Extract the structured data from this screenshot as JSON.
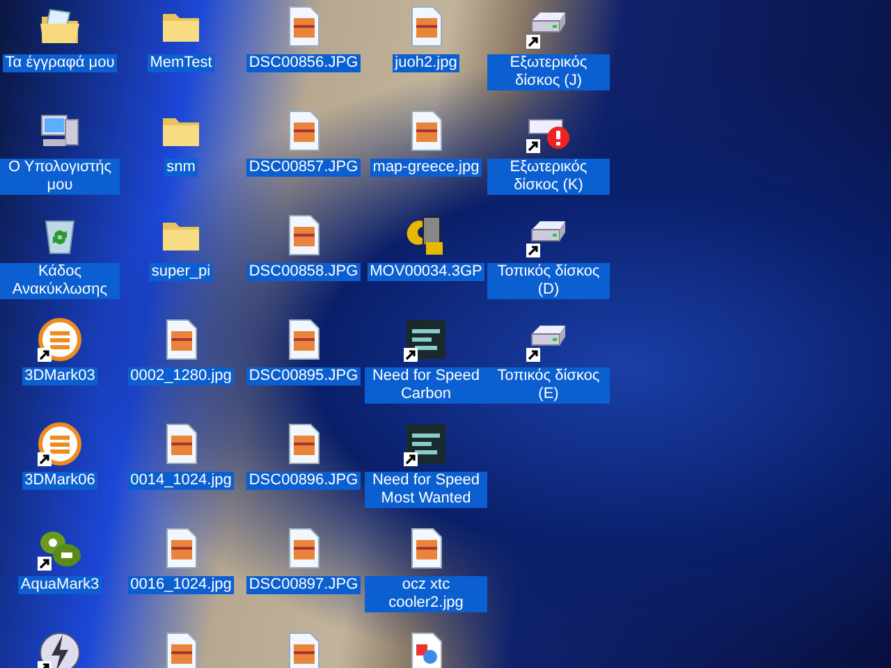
{
  "desktop": {
    "icons": [
      {
        "kind": "documents",
        "label": "Τα έγγραφά μου",
        "shortcut": false,
        "selected": true
      },
      {
        "kind": "computer",
        "label": "Ο Υπολογιστής μου",
        "shortcut": false,
        "selected": true
      },
      {
        "kind": "recycle",
        "label": "Κάδος Ανακύκλωσης",
        "shortcut": false,
        "selected": true
      },
      {
        "kind": "benchmark",
        "label": "3DMark03",
        "shortcut": true,
        "selected": true
      },
      {
        "kind": "benchmark",
        "label": "3DMark06",
        "shortcut": true,
        "selected": true
      },
      {
        "kind": "aquamark",
        "label": "AquaMark3",
        "shortcut": true,
        "selected": true
      },
      {
        "kind": "lightning",
        "shortcut": true
      },
      {
        "kind": "folder",
        "label": "MemTest",
        "shortcut": false,
        "selected": true
      },
      {
        "kind": "folder",
        "label": "snm",
        "shortcut": false,
        "selected": true
      },
      {
        "kind": "folder",
        "label": "super_pi",
        "shortcut": false,
        "selected": true
      },
      {
        "kind": "image",
        "label": "0002_1280.jpg",
        "shortcut": false,
        "selected": true
      },
      {
        "kind": "image",
        "label": "0014_1024.jpg",
        "shortcut": false,
        "selected": true
      },
      {
        "kind": "image",
        "label": "0016_1024.jpg",
        "shortcut": false,
        "selected": true
      },
      {
        "kind": "image"
      },
      {
        "kind": "image",
        "label": "DSC00856.JPG",
        "shortcut": false,
        "selected": true
      },
      {
        "kind": "image",
        "label": "DSC00857.JPG",
        "shortcut": false,
        "selected": true
      },
      {
        "kind": "image",
        "label": "DSC00858.JPG",
        "shortcut": false,
        "selected": true
      },
      {
        "kind": "image",
        "label": "DSC00895.JPG",
        "shortcut": false,
        "selected": true
      },
      {
        "kind": "image",
        "label": "DSC00896.JPG",
        "shortcut": false,
        "selected": true
      },
      {
        "kind": "image",
        "label": "DSC00897.JPG",
        "shortcut": false,
        "selected": true
      },
      {
        "kind": "image"
      },
      {
        "kind": "image",
        "label": "juoh2.jpg",
        "shortcut": false,
        "selected": true
      },
      {
        "kind": "image",
        "label": "map-greece.jpg",
        "shortcut": false,
        "selected": true
      },
      {
        "kind": "video",
        "label": "MOV00034.3GP",
        "shortcut": false,
        "selected": true
      },
      {
        "kind": "game",
        "label": "Need for Speed Carbon",
        "shortcut": true,
        "selected": true
      },
      {
        "kind": "game",
        "label": "Need for Speed Most Wanted",
        "shortcut": true,
        "selected": true
      },
      {
        "kind": "image",
        "label": "ocz xtc cooler2.jpg",
        "shortcut": false,
        "selected": true
      },
      {
        "kind": "picture"
      },
      {
        "kind": "drive",
        "label": "Εξωτερικός δίσκος (J)",
        "shortcut": true,
        "selected": true
      },
      {
        "kind": "drive-missing",
        "label": "Εξωτερικός δίσκος (K)",
        "shortcut": true,
        "selected": true
      },
      {
        "kind": "drive",
        "label": "Τοπικός δίσκος (D)",
        "shortcut": true,
        "selected": true
      },
      {
        "kind": "drive",
        "label": "Τοπικός δίσκος (E)",
        "shortcut": true,
        "selected": true
      }
    ]
  }
}
